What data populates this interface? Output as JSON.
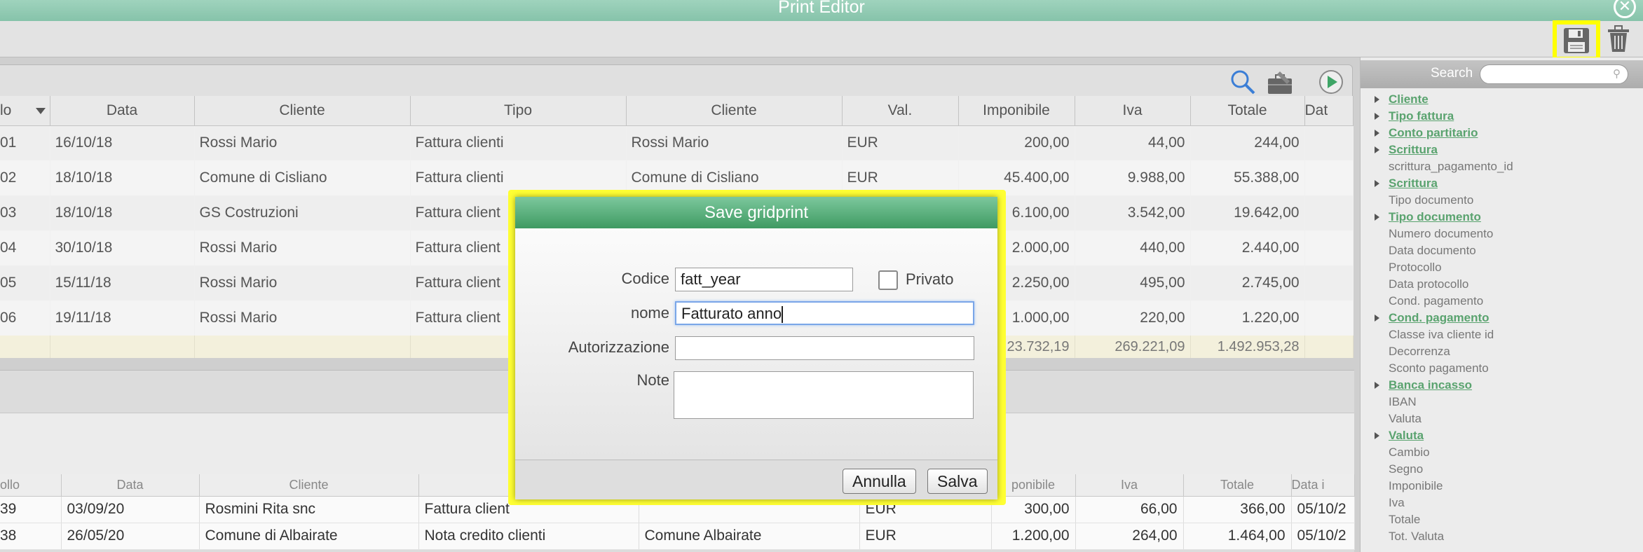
{
  "window": {
    "title": "Print Editor",
    "close_glyph": "✕"
  },
  "toolbar": {
    "save_icon": "floppy-disk-icon",
    "delete_icon": "trash-icon"
  },
  "grid_toolbar": {
    "icons": [
      "search-icon",
      "toolbox-icon",
      "play-icon"
    ]
  },
  "main_grid": {
    "columns": [
      "lo",
      "Data",
      "Cliente",
      "Tipo",
      "Cliente",
      "Val.",
      "Imponibile",
      "Iva",
      "Totale",
      "Dat"
    ],
    "rows": [
      [
        "01",
        "16/10/18",
        "Rossi Mario",
        "Fattura clienti",
        "Rossi Mario",
        "EUR",
        "200,00",
        "44,00",
        "244,00"
      ],
      [
        "02",
        "18/10/18",
        "Comune di Cisliano",
        "Fattura clienti",
        "Comune di Cisliano",
        "EUR",
        "45.400,00",
        "9.988,00",
        "55.388,00"
      ],
      [
        "03",
        "18/10/18",
        "GS Costruzioni",
        "Fattura client",
        "",
        "",
        "6.100,00",
        "3.542,00",
        "19.642,00"
      ],
      [
        "04",
        "30/10/18",
        "Rossi Mario",
        "Fattura client",
        "",
        "",
        "2.000,00",
        "440,00",
        "2.440,00"
      ],
      [
        "05",
        "15/11/18",
        "Rossi Mario",
        "Fattura client",
        "",
        "",
        "2.250,00",
        "495,00",
        "2.745,00"
      ],
      [
        "06",
        "19/11/18",
        "Rossi Mario",
        "Fattura client",
        "",
        "",
        "1.000,00",
        "220,00",
        "1.220,00"
      ]
    ],
    "totals": [
      "23.732,19",
      "269.221,09",
      "1.492.953,28"
    ]
  },
  "bottom_grid": {
    "columns": [
      "ollo",
      "Data",
      "Cliente",
      "",
      "",
      "",
      "ponibile",
      "Iva",
      "Totale",
      "Data i"
    ],
    "rows": [
      [
        "39",
        "03/09/20",
        "Rosmini Rita snc",
        "Fattura client",
        "",
        "EUR",
        "300,00",
        "66,00",
        "366,00",
        "05/10/2"
      ],
      [
        "38",
        "26/05/20",
        "Comune di Albairate",
        "Nota credito clienti",
        "Comune Albairate",
        "EUR",
        "1.200,00",
        "264,00",
        "1.464,00",
        "05/10/2"
      ]
    ]
  },
  "sidebar": {
    "search_label": "Search",
    "search_placeholder": "",
    "items": [
      {
        "label": "Cliente",
        "type": "link"
      },
      {
        "label": "Tipo fattura",
        "type": "link"
      },
      {
        "label": "Conto partitario",
        "type": "link"
      },
      {
        "label": "Scrittura",
        "type": "link"
      },
      {
        "label": "scrittura_pagamento_id",
        "type": "field"
      },
      {
        "label": "Scrittura",
        "type": "link"
      },
      {
        "label": "Tipo documento",
        "type": "field"
      },
      {
        "label": "Tipo documento",
        "type": "link"
      },
      {
        "label": "Numero documento",
        "type": "field"
      },
      {
        "label": "Data documento",
        "type": "field"
      },
      {
        "label": "Protocollo",
        "type": "field"
      },
      {
        "label": "Data protocollo",
        "type": "field"
      },
      {
        "label": "Cond. pagamento",
        "type": "field"
      },
      {
        "label": "Cond. pagamento",
        "type": "link"
      },
      {
        "label": "Classe iva cliente id",
        "type": "field"
      },
      {
        "label": "Decorrenza",
        "type": "field"
      },
      {
        "label": "Sconto pagamento",
        "type": "field"
      },
      {
        "label": "Banca incasso",
        "type": "link"
      },
      {
        "label": "IBAN",
        "type": "field"
      },
      {
        "label": "Valuta",
        "type": "field"
      },
      {
        "label": "Valuta",
        "type": "link"
      },
      {
        "label": "Cambio",
        "type": "field"
      },
      {
        "label": "Segno",
        "type": "field"
      },
      {
        "label": "Imponibile",
        "type": "field"
      },
      {
        "label": "Iva",
        "type": "field"
      },
      {
        "label": "Totale",
        "type": "field"
      },
      {
        "label": "Tot. Valuta",
        "type": "field"
      }
    ]
  },
  "dialog": {
    "title": "Save gridprint",
    "codice_label": "Codice",
    "codice_value": "fatt_year",
    "privato_label": "Privato",
    "nome_label": "nome",
    "nome_value": "Fatturato anno",
    "autorizzazione_label": "Autorizzazione",
    "autorizzazione_value": "",
    "note_label": "Note",
    "note_value": "",
    "cancel_label": "Annulla",
    "save_label": "Salva"
  },
  "colors": {
    "accent": "#4ea56f",
    "highlight": "#ffff00",
    "link": "#5aa36f"
  }
}
